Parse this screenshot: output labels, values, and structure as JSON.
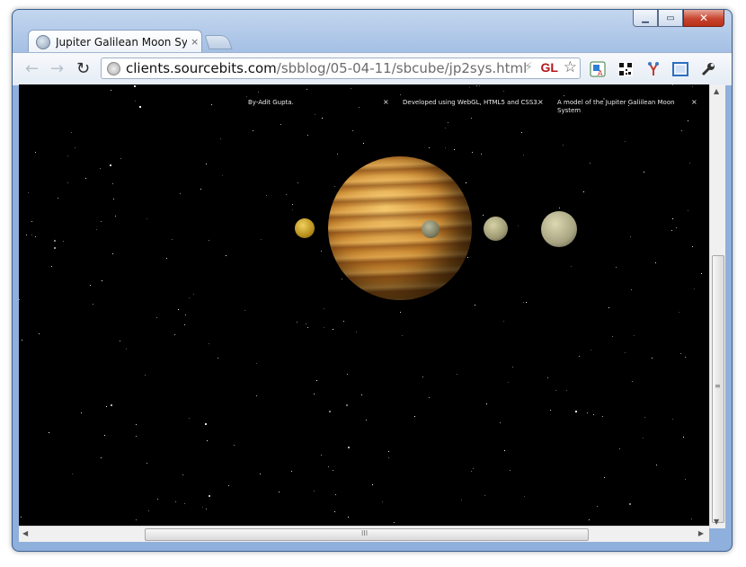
{
  "window": {
    "caption_buttons": [
      "minimize",
      "maximize",
      "close"
    ],
    "close_glyph": "✕",
    "min_glyph": "▁",
    "max_glyph": "▭"
  },
  "tab": {
    "title": "Jupiter Galilean Moon Syste",
    "close": "×"
  },
  "toolbar": {
    "back": "←",
    "forward": "→",
    "reload": "↻",
    "url_host": "clients.sourcebits.com",
    "url_path": "/sbblog/05-04-11/sbcube/jp2sys.html",
    "bolt": "⚡",
    "gl_label": "GL",
    "star": "☆",
    "extensions": [
      "translate-icon",
      "qr-code-icon",
      "fork-icon",
      "fullscreen-icon",
      "wrench-icon"
    ],
    "wrench": "🔧"
  },
  "page": {
    "captions": [
      {
        "text": "By-Adit Gupta.",
        "close": "×"
      },
      {
        "text": "Developed using WebGL, HTML5 and CSS3.",
        "close": "×"
      },
      {
        "text": "A model of the Jupiter Galiilean Moon System",
        "close": "×"
      }
    ],
    "scene": {
      "planet": "Jupiter",
      "moons": [
        "Io",
        "Europa",
        "Ganymede",
        "Callisto"
      ]
    },
    "colors": {
      "background": "#000000",
      "jupiter": "#c9862f",
      "io": "#c9a52a",
      "europa": "#8a8a6a",
      "ganymede": "#9e9a74",
      "callisto": "#a8a482"
    }
  },
  "scrollbars": {
    "up": "▲",
    "down": "▼",
    "left": "◀",
    "right": "▶",
    "grip_v": "≡",
    "grip_h": "III"
  }
}
